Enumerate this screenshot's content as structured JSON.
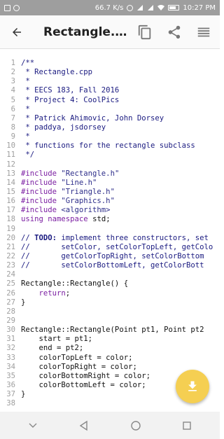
{
  "status_bar": {
    "speed": "66.7 K/s",
    "time": "10:27 PM",
    "icons": [
      "notification-box-icon",
      "loop-icon",
      "alarm-icon",
      "signal-icon",
      "signal-icon",
      "wifi-icon",
      "battery-icon"
    ]
  },
  "app_bar": {
    "title": "Rectangle.cpp",
    "back_icon": "arrow-back-icon",
    "actions": [
      "copy-icon",
      "share-icon",
      "menu-icon"
    ]
  },
  "code": {
    "lines": [
      {
        "n": "1",
        "parts": [
          {
            "cls": "t-comment",
            "text": "/**"
          }
        ]
      },
      {
        "n": "2",
        "parts": [
          {
            "cls": "t-comment",
            "text": " * Rectangle.cpp"
          }
        ]
      },
      {
        "n": "3",
        "parts": [
          {
            "cls": "t-comment",
            "text": " *"
          }
        ]
      },
      {
        "n": "4",
        "parts": [
          {
            "cls": "t-comment",
            "text": " * EECS 183, Fall 2016"
          }
        ]
      },
      {
        "n": "5",
        "parts": [
          {
            "cls": "t-comment",
            "text": " * Project 4: CoolPics"
          }
        ]
      },
      {
        "n": "6",
        "parts": [
          {
            "cls": "t-comment",
            "text": " *"
          }
        ]
      },
      {
        "n": "7",
        "parts": [
          {
            "cls": "t-comment",
            "text": " * Patrick Ahimovic, John Dorsey"
          }
        ]
      },
      {
        "n": "8",
        "parts": [
          {
            "cls": "t-comment",
            "text": " * paddya, jsdorsey"
          }
        ]
      },
      {
        "n": "9",
        "parts": [
          {
            "cls": "t-comment",
            "text": " *"
          }
        ]
      },
      {
        "n": "10",
        "parts": [
          {
            "cls": "t-comment",
            "text": " * functions for the rectangle subclass"
          }
        ]
      },
      {
        "n": "11",
        "parts": [
          {
            "cls": "t-comment",
            "text": " */"
          }
        ]
      },
      {
        "n": "12",
        "parts": [
          {
            "cls": "t-plain",
            "text": ""
          }
        ]
      },
      {
        "n": "13",
        "parts": [
          {
            "cls": "t-keyword",
            "text": "#include "
          },
          {
            "cls": "t-string",
            "text": "\"Rectangle.h\""
          }
        ]
      },
      {
        "n": "14",
        "parts": [
          {
            "cls": "t-keyword",
            "text": "#include "
          },
          {
            "cls": "t-string",
            "text": "\"Line.h\""
          }
        ]
      },
      {
        "n": "15",
        "parts": [
          {
            "cls": "t-keyword",
            "text": "#include "
          },
          {
            "cls": "t-string",
            "text": "\"Triangle.h\""
          }
        ]
      },
      {
        "n": "16",
        "parts": [
          {
            "cls": "t-keyword",
            "text": "#include "
          },
          {
            "cls": "t-string",
            "text": "\"Graphics.h\""
          }
        ]
      },
      {
        "n": "17",
        "parts": [
          {
            "cls": "t-keyword",
            "text": "#include "
          },
          {
            "cls": "t-string",
            "text": "<algorithm>"
          }
        ]
      },
      {
        "n": "18",
        "parts": [
          {
            "cls": "t-keyword",
            "text": "using namespace "
          },
          {
            "cls": "t-plain",
            "text": "std;"
          }
        ]
      },
      {
        "n": "19",
        "parts": [
          {
            "cls": "t-plain",
            "text": ""
          }
        ]
      },
      {
        "n": "20",
        "parts": [
          {
            "cls": "t-comment",
            "text": "// "
          },
          {
            "cls": "t-todo",
            "text": "TODO:"
          },
          {
            "cls": "t-comment",
            "text": " implement three constructors, set"
          }
        ]
      },
      {
        "n": "21",
        "parts": [
          {
            "cls": "t-comment",
            "text": "//       setColor, setColorTopLeft, getColo"
          }
        ]
      },
      {
        "n": "22",
        "parts": [
          {
            "cls": "t-comment",
            "text": "//       getColorTopRight, setColorBottom"
          }
        ]
      },
      {
        "n": "23",
        "parts": [
          {
            "cls": "t-comment",
            "text": "//       setColorBottomLeft, getColorBott"
          }
        ]
      },
      {
        "n": "24",
        "parts": [
          {
            "cls": "t-plain",
            "text": ""
          }
        ]
      },
      {
        "n": "25",
        "parts": [
          {
            "cls": "t-plain",
            "text": "Rectangle::Rectangle() {"
          }
        ]
      },
      {
        "n": "26",
        "parts": [
          {
            "cls": "t-keyword",
            "text": "    return"
          },
          {
            "cls": "t-plain",
            "text": ";"
          }
        ]
      },
      {
        "n": "27",
        "parts": [
          {
            "cls": "t-plain",
            "text": "}"
          }
        ]
      },
      {
        "n": "28",
        "parts": [
          {
            "cls": "t-plain",
            "text": ""
          }
        ]
      },
      {
        "n": "29",
        "parts": [
          {
            "cls": "t-plain",
            "text": ""
          }
        ]
      },
      {
        "n": "30",
        "parts": [
          {
            "cls": "t-plain",
            "text": "Rectangle::Rectangle(Point pt1, Point pt2"
          }
        ]
      },
      {
        "n": "31",
        "parts": [
          {
            "cls": "t-plain",
            "text": "    start = pt1;"
          }
        ]
      },
      {
        "n": "32",
        "parts": [
          {
            "cls": "t-plain",
            "text": "    end = pt2;"
          }
        ]
      },
      {
        "n": "33",
        "parts": [
          {
            "cls": "t-plain",
            "text": "    colorTopLeft = color;"
          }
        ]
      },
      {
        "n": "34",
        "parts": [
          {
            "cls": "t-plain",
            "text": "    colorTopRight = color;"
          }
        ]
      },
      {
        "n": "35",
        "parts": [
          {
            "cls": "t-plain",
            "text": "    colorBottomRight = color;"
          }
        ]
      },
      {
        "n": "36",
        "parts": [
          {
            "cls": "t-plain",
            "text": "    colorBottomLeft = color;"
          }
        ]
      },
      {
        "n": "37",
        "parts": [
          {
            "cls": "t-plain",
            "text": "}"
          }
        ]
      },
      {
        "n": "38",
        "parts": [
          {
            "cls": "t-plain",
            "text": ""
          }
        ]
      }
    ]
  },
  "fab": {
    "icon": "download-icon",
    "color": "#f5cf52"
  },
  "nav_bar": {
    "buttons": [
      "hide-keyboard-chevron-icon",
      "back-triangle-icon",
      "home-circle-icon",
      "recents-square-icon"
    ]
  },
  "colors": {
    "status_bar": "#9e9e9e",
    "app_bar": "#fafafa",
    "comment": "#1a1a80",
    "keyword": "#7b1fa2",
    "line_number": "#9e9e9e"
  }
}
